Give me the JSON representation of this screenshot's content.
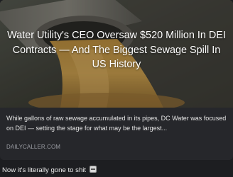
{
  "link_card": {
    "image_headline": "Water Utility's CEO Oversaw $520 Million In DEI Contracts — And The Biggest Sewage Spill In US History",
    "description": "While gallons of raw sewage accumulated in its pipes, DC Water was focused on DEI — setting the stage for what may be the largest...",
    "domain": "DAILYCALLER.COM"
  },
  "post": {
    "text": "Now it's literally gone to shit",
    "emoji": "office-building-emoji"
  },
  "colors": {
    "background": "#1d1e21",
    "card": "#26272b",
    "domain_text": "#9a9ca3"
  }
}
